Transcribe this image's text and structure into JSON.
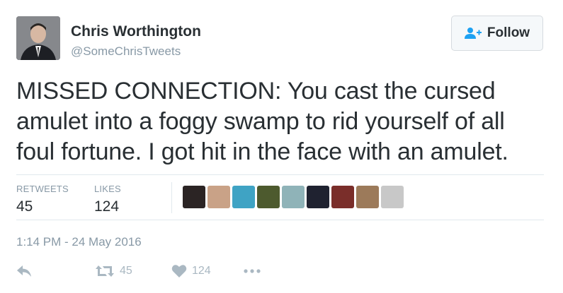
{
  "author": {
    "name": "Chris Worthington",
    "handle": "@SomeChrisTweets"
  },
  "follow_button": {
    "label": "Follow",
    "icon": "person-plus-icon"
  },
  "tweet": {
    "lines": [
      "MISSED CONNECTION: You cast the cursed",
      "amulet into a foggy swamp to rid yourself of all",
      "foul fortune. I got hit in the face with an amulet."
    ]
  },
  "stats": {
    "retweets_label": "RETWEETS",
    "retweets_value": "45",
    "likes_label": "LIKES",
    "likes_value": "124"
  },
  "likers": [
    {
      "name": "liker-avatar-1",
      "color": "#2b2424"
    },
    {
      "name": "liker-avatar-2",
      "color": "#c9a287"
    },
    {
      "name": "liker-avatar-3",
      "color": "#3fa3c4"
    },
    {
      "name": "liker-avatar-4",
      "color": "#4d5a2e"
    },
    {
      "name": "liker-avatar-5",
      "color": "#8fb3b8"
    },
    {
      "name": "liker-avatar-6",
      "color": "#1f2230"
    },
    {
      "name": "liker-avatar-7",
      "color": "#7a2e2a"
    },
    {
      "name": "liker-avatar-8",
      "color": "#9c7a5a"
    },
    {
      "name": "liker-avatar-9",
      "color": "#c8c8c8"
    }
  ],
  "timestamp": "1:14 PM - 24 May 2016",
  "actions": {
    "reply_icon": "reply-icon",
    "retweet_icon": "retweet-icon",
    "retweet_count": "45",
    "like_icon": "heart-icon",
    "like_count": "124",
    "more_icon": "more-dots-icon"
  },
  "colors": {
    "text": "#292f33",
    "muted": "#8899a6",
    "action": "#aab8c2",
    "follow_icon": "#1da1f2"
  }
}
